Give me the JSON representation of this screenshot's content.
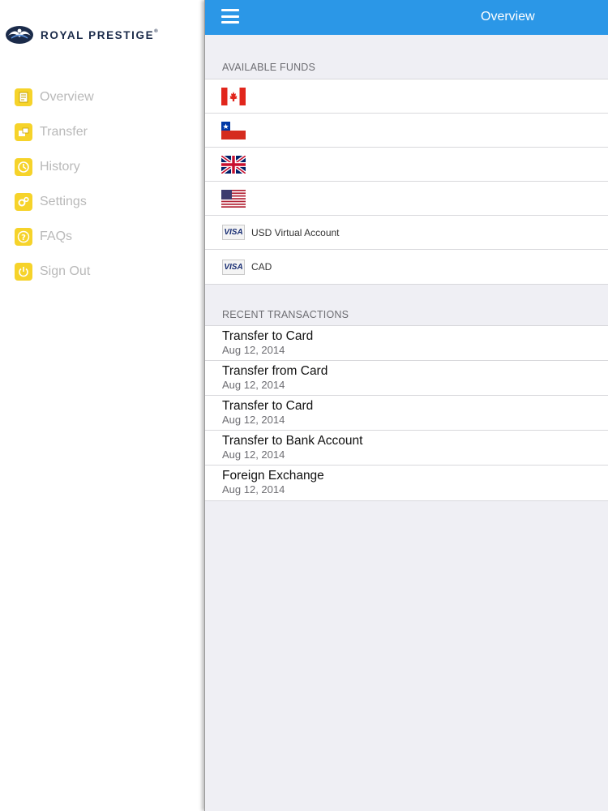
{
  "sidebar": {
    "logo_text": "ROYAL PRESTIGE",
    "logo_mark": "®",
    "items": [
      {
        "label": "Overview",
        "icon": "document-icon"
      },
      {
        "label": "Transfer",
        "icon": "transfer-icon"
      },
      {
        "label": "History",
        "icon": "clock-icon"
      },
      {
        "label": "Settings",
        "icon": "gears-icon"
      },
      {
        "label": "FAQs",
        "icon": "question-icon"
      },
      {
        "label": "Sign Out",
        "icon": "power-icon"
      }
    ]
  },
  "header": {
    "title": "Overview"
  },
  "funds": {
    "section_title": "AVAILABLE FUNDS",
    "items": [
      {
        "flag": "canada-flag-icon",
        "label": ""
      },
      {
        "flag": "chile-flag-icon",
        "label": ""
      },
      {
        "flag": "uk-flag-icon",
        "label": ""
      },
      {
        "flag": "usa-flag-icon",
        "label": ""
      },
      {
        "card": "VISA",
        "label": "USD Virtual Account"
      },
      {
        "card": "VISA",
        "label": "CAD"
      }
    ]
  },
  "transactions": {
    "section_title": "RECENT TRANSACTIONS",
    "items": [
      {
        "title": "Transfer to Card",
        "date": "Aug 12, 2014"
      },
      {
        "title": "Transfer from Card",
        "date": "Aug 12, 2014"
      },
      {
        "title": "Transfer to Card",
        "date": "Aug 12, 2014"
      },
      {
        "title": "Transfer to Bank Account",
        "date": "Aug 12, 2014"
      },
      {
        "title": "Foreign Exchange",
        "date": "Aug 12, 2014"
      }
    ]
  },
  "colors": {
    "header_blue": "#2b97e7",
    "icon_yellow": "#f6d32a",
    "sidebar_text": "#b9b9b9",
    "background": "#efeff4"
  }
}
